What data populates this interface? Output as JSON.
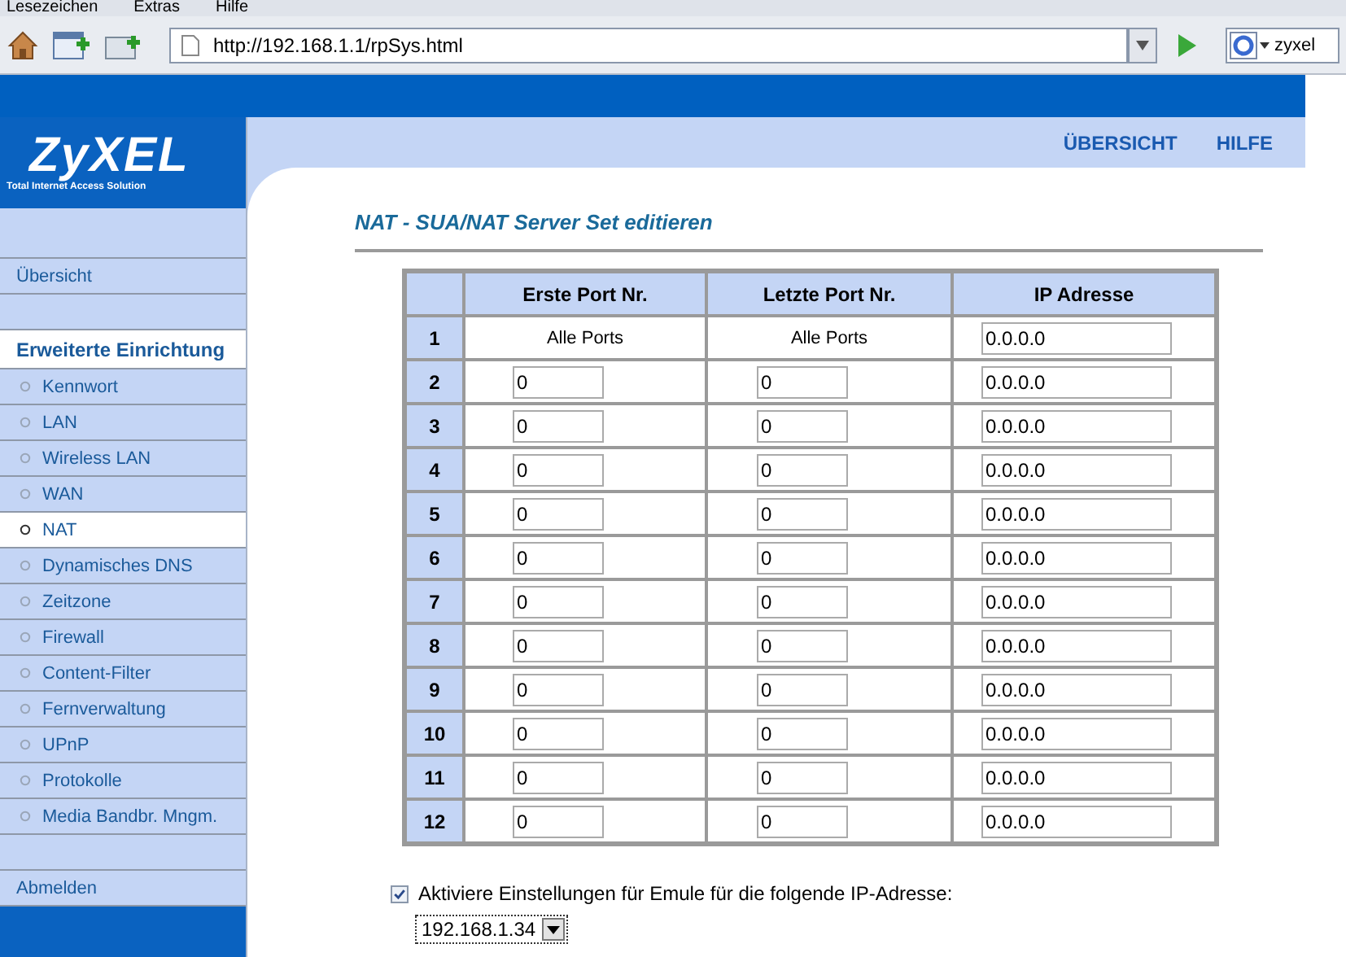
{
  "browser": {
    "menu": [
      "Lesezeichen",
      "Extras",
      "Hilfe"
    ],
    "url": "http://192.168.1.1/rpSys.html",
    "search": "zyxel"
  },
  "logo": {
    "brand": "ZyXEL",
    "tagline": "Total Internet Access Solution"
  },
  "top_links": [
    "ÜBERSICHT",
    "HILFE"
  ],
  "sidebar": {
    "items": [
      {
        "kind": "blank"
      },
      {
        "kind": "link",
        "label": "Übersicht",
        "selected": false
      },
      {
        "kind": "blank"
      },
      {
        "kind": "heading",
        "label": "Erweiterte Einrichtung"
      },
      {
        "kind": "sub",
        "label": "Kennwort",
        "selected": false
      },
      {
        "kind": "sub",
        "label": "LAN",
        "selected": false
      },
      {
        "kind": "sub",
        "label": "Wireless LAN",
        "selected": false
      },
      {
        "kind": "sub",
        "label": "WAN",
        "selected": false
      },
      {
        "kind": "sub",
        "label": "NAT",
        "selected": true
      },
      {
        "kind": "sub",
        "label": "Dynamisches DNS",
        "selected": false
      },
      {
        "kind": "sub",
        "label": "Zeitzone",
        "selected": false
      },
      {
        "kind": "sub",
        "label": "Firewall",
        "selected": false
      },
      {
        "kind": "sub",
        "label": "Content-Filter",
        "selected": false
      },
      {
        "kind": "sub",
        "label": "Fernverwaltung",
        "selected": false
      },
      {
        "kind": "sub",
        "label": "UPnP",
        "selected": false
      },
      {
        "kind": "sub",
        "label": "Protokolle",
        "selected": false
      },
      {
        "kind": "sub",
        "label": "Media Bandbr. Mngm.",
        "selected": false
      },
      {
        "kind": "blank"
      },
      {
        "kind": "link",
        "label": "Abmelden",
        "selected": false
      }
    ]
  },
  "page_title": "NAT - SUA/NAT Server Set editieren",
  "table": {
    "columns": [
      "Erste Port Nr.",
      "Letzte Port Nr.",
      "IP Adresse"
    ],
    "rows": [
      {
        "num": "1",
        "first": "Alle Ports",
        "last": "Alle Ports",
        "ip": "0.0.0.0",
        "editable_ports": false
      },
      {
        "num": "2",
        "first": "0",
        "last": "0",
        "ip": "0.0.0.0",
        "editable_ports": true
      },
      {
        "num": "3",
        "first": "0",
        "last": "0",
        "ip": "0.0.0.0",
        "editable_ports": true
      },
      {
        "num": "4",
        "first": "0",
        "last": "0",
        "ip": "0.0.0.0",
        "editable_ports": true
      },
      {
        "num": "5",
        "first": "0",
        "last": "0",
        "ip": "0.0.0.0",
        "editable_ports": true
      },
      {
        "num": "6",
        "first": "0",
        "last": "0",
        "ip": "0.0.0.0",
        "editable_ports": true
      },
      {
        "num": "7",
        "first": "0",
        "last": "0",
        "ip": "0.0.0.0",
        "editable_ports": true
      },
      {
        "num": "8",
        "first": "0",
        "last": "0",
        "ip": "0.0.0.0",
        "editable_ports": true
      },
      {
        "num": "9",
        "first": "0",
        "last": "0",
        "ip": "0.0.0.0",
        "editable_ports": true
      },
      {
        "num": "10",
        "first": "0",
        "last": "0",
        "ip": "0.0.0.0",
        "editable_ports": true
      },
      {
        "num": "11",
        "first": "0",
        "last": "0",
        "ip": "0.0.0.0",
        "editable_ports": true
      },
      {
        "num": "12",
        "first": "0",
        "last": "0",
        "ip": "0.0.0.0",
        "editable_ports": true
      }
    ]
  },
  "emule": {
    "label": "Aktiviere Einstellungen für Emule für die folgende IP-Adresse:",
    "checked": true,
    "ip": "192.168.1.34"
  }
}
